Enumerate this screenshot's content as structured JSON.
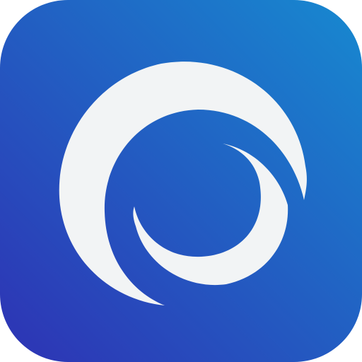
{
  "icon": {
    "name": "swirl-logo-icon",
    "colors": {
      "gradient_top_right": "#1789D0",
      "gradient_bottom_left": "#2E32B4",
      "mark": "#F2F4F5"
    }
  }
}
